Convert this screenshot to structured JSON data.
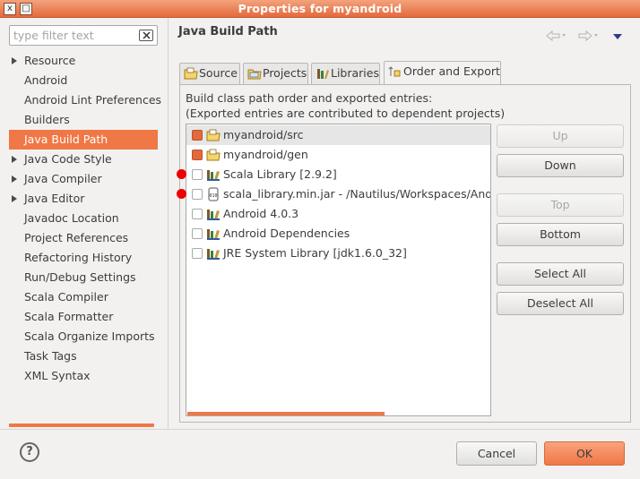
{
  "window": {
    "title": "Properties for myandroid",
    "close_glyph": "x",
    "restore_glyph": "□"
  },
  "filter": {
    "placeholder": "type filter text",
    "clear_icon": "clear-icon"
  },
  "tree": {
    "items": [
      {
        "label": "Resource",
        "expandable": true,
        "selected": false
      },
      {
        "label": "Android",
        "expandable": false,
        "selected": false
      },
      {
        "label": "Android Lint Preferences",
        "expandable": false,
        "selected": false
      },
      {
        "label": "Builders",
        "expandable": false,
        "selected": false
      },
      {
        "label": "Java Build Path",
        "expandable": false,
        "selected": true
      },
      {
        "label": "Java Code Style",
        "expandable": true,
        "selected": false
      },
      {
        "label": "Java Compiler",
        "expandable": true,
        "selected": false
      },
      {
        "label": "Java Editor",
        "expandable": true,
        "selected": false
      },
      {
        "label": "Javadoc Location",
        "expandable": false,
        "selected": false
      },
      {
        "label": "Project References",
        "expandable": false,
        "selected": false
      },
      {
        "label": "Refactoring History",
        "expandable": false,
        "selected": false
      },
      {
        "label": "Run/Debug Settings",
        "expandable": false,
        "selected": false
      },
      {
        "label": "Scala Compiler",
        "expandable": false,
        "selected": false
      },
      {
        "label": "Scala Formatter",
        "expandable": false,
        "selected": false
      },
      {
        "label": "Scala Organize Imports",
        "expandable": false,
        "selected": false
      },
      {
        "label": "Task Tags",
        "expandable": false,
        "selected": false
      },
      {
        "label": "XML Syntax",
        "expandable": false,
        "selected": false
      }
    ]
  },
  "pane": {
    "title": "Java Build Path"
  },
  "tabs": [
    {
      "label": "Source",
      "icon": "source-folder-icon",
      "active": false
    },
    {
      "label": "Projects",
      "icon": "projects-icon",
      "active": false
    },
    {
      "label": "Libraries",
      "icon": "libraries-icon",
      "active": false
    },
    {
      "label": "Order and Export",
      "icon": "order-export-icon",
      "active": true
    }
  ],
  "order_export": {
    "description_line1": "Build class path order and exported entries:",
    "description_line2": "(Exported entries are contributed to dependent projects)",
    "entries": [
      {
        "label": "myandroid/src",
        "checked": true,
        "selected": true,
        "icon": "source-folder-icon",
        "marked": false
      },
      {
        "label": "myandroid/gen",
        "checked": true,
        "selected": false,
        "icon": "source-folder-icon",
        "marked": false
      },
      {
        "label": "Scala Library [2.9.2]",
        "checked": false,
        "selected": false,
        "icon": "library-icon",
        "marked": true
      },
      {
        "label": "scala_library.min.jar - /Nautilus/Workspaces/Android",
        "checked": false,
        "selected": false,
        "icon": "jar-icon",
        "marked": true
      },
      {
        "label": "Android 4.0.3",
        "checked": false,
        "selected": false,
        "icon": "library-icon",
        "marked": false
      },
      {
        "label": "Android Dependencies",
        "checked": false,
        "selected": false,
        "icon": "library-icon",
        "marked": false
      },
      {
        "label": "JRE System Library [jdk1.6.0_32]",
        "checked": false,
        "selected": false,
        "icon": "library-icon",
        "marked": false
      }
    ],
    "buttons": {
      "up": "Up",
      "down": "Down",
      "top": "Top",
      "bottom": "Bottom",
      "select_all": "Select All",
      "deselect_all": "Deselect All"
    }
  },
  "footer": {
    "help": "?",
    "cancel": "Cancel",
    "ok": "OK"
  },
  "colors": {
    "accent": "#f07746",
    "marker": "#ee0000"
  }
}
